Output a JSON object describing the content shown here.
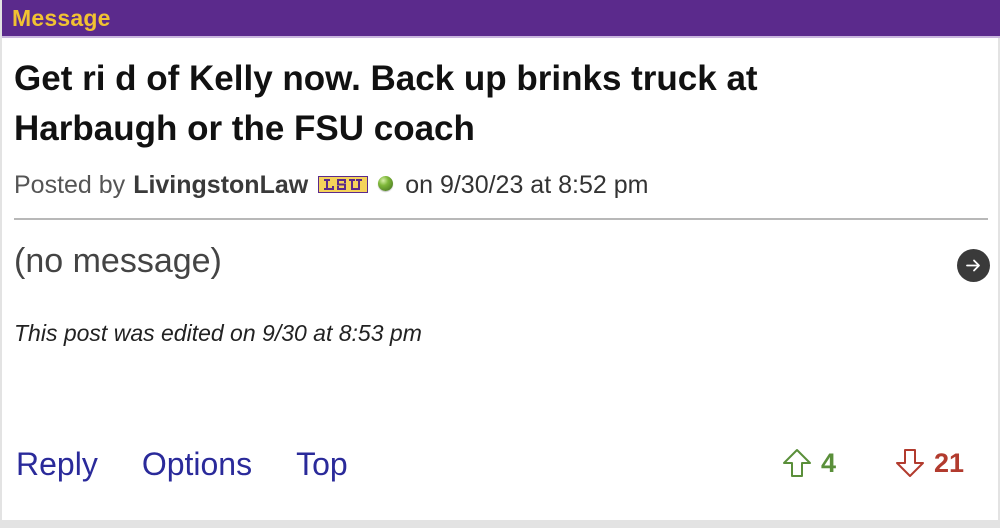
{
  "header": {
    "label": "Message",
    "background": "#5b2a8c",
    "label_color": "#f1c232"
  },
  "post": {
    "title": "Get ri d of Kelly now. Back up brinks truck at Harbaugh or the FSU coach",
    "posted_by_label": "Posted by",
    "author": "LivingstonLaw",
    "team_badge_icon": "lsu-logo-icon",
    "status_icon": "online-status-icon",
    "date_text": "on 9/30/23 at 8:52 pm",
    "body": "(no message)",
    "edited_note": "This post was edited on 9/30 at 8:53 pm"
  },
  "actions": {
    "reply_label": "Reply",
    "options_label": "Options",
    "top_label": "Top",
    "next_icon": "arrow-right-icon"
  },
  "votes": {
    "up_count": "4",
    "down_count": "21",
    "up_color": "#5a8f3a",
    "down_color": "#b23b2e"
  }
}
